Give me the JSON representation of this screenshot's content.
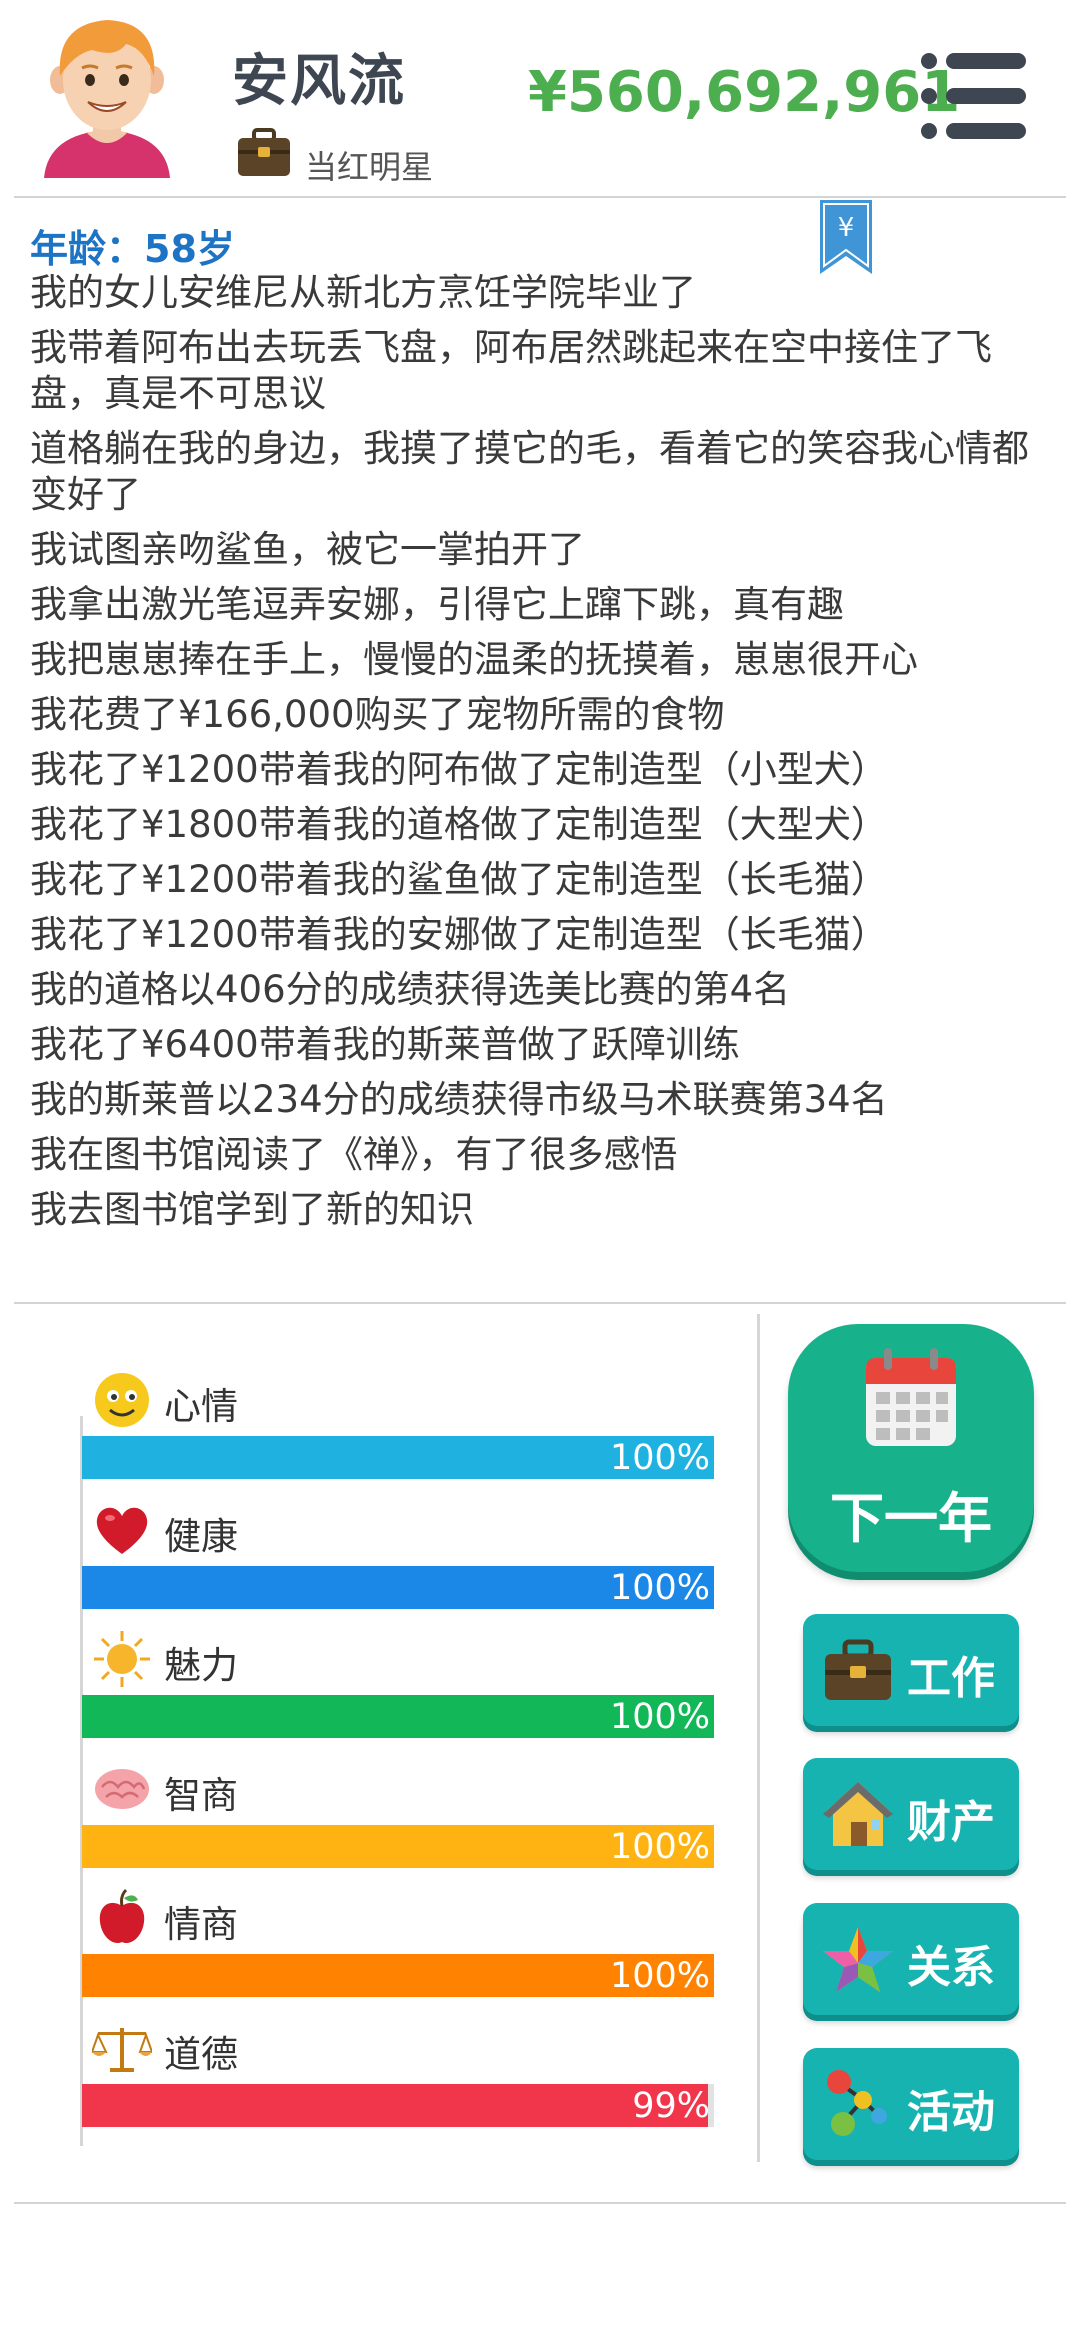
{
  "player": {
    "name": "安风流",
    "job": "当红明星",
    "money": "¥560,692,961",
    "age": "年龄：58岁"
  },
  "icons": {
    "avatar": "avatar-boy",
    "job": "briefcase-icon",
    "menu": "menu-icon",
    "bookmark": "yuan-bookmark-icon"
  },
  "log": [
    "我的女儿安维尼从新北方烹饪学院毕业了",
    "我带着阿布出去玩丢飞盘，阿布居然跳起来在空中接住了飞盘，真是不可思议",
    "道格躺在我的身边，我摸了摸它的毛，看着它的笑容我心情都变好了",
    "我试图亲吻鲨鱼，被它一掌拍开了",
    "我拿出激光笔逗弄安娜，引得它上蹿下跳，真有趣",
    "我把崽崽捧在手上，慢慢的温柔的抚摸着，崽崽很开心",
    "我花费了¥166,000购买了宠物所需的食物",
    "我花了¥1200带着我的阿布做了定制造型（小型犬）",
    "我花了¥1800带着我的道格做了定制造型（大型犬）",
    "我花了¥1200带着我的鲨鱼做了定制造型（长毛猫）",
    "我花了¥1200带着我的安娜做了定制造型（长毛猫）",
    "我的道格以406分的成绩获得选美比赛的第4名",
    "我花了¥6400带着我的斯莱普做了跃障训练",
    "我的斯莱普以234分的成绩获得市级马术联赛第34名",
    "我在图书馆阅读了《禅》，有了很多感悟",
    "我去图书馆学到了新的知识"
  ],
  "stats": [
    {
      "label": "心情",
      "value": 100,
      "text": "100%",
      "color": "#1fb2e0",
      "icon": "smiley-icon"
    },
    {
      "label": "健康",
      "value": 100,
      "text": "100%",
      "color": "#1b87e6",
      "icon": "heart-icon"
    },
    {
      "label": "魅力",
      "value": 100,
      "text": "100%",
      "color": "#12b857",
      "icon": "sun-icon"
    },
    {
      "label": "智商",
      "value": 100,
      "text": "100%",
      "color": "#ffb312",
      "icon": "brain-icon"
    },
    {
      "label": "情商",
      "value": 100,
      "text": "100%",
      "color": "#ff8200",
      "icon": "apple-icon"
    },
    {
      "label": "道德",
      "value": 99,
      "text": "99%",
      "color": "#f1364b",
      "icon": "scales-icon"
    }
  ],
  "actions": {
    "next_year": "下一年",
    "work": "工作",
    "property": "财产",
    "relations": "关系",
    "activities": "活动"
  }
}
